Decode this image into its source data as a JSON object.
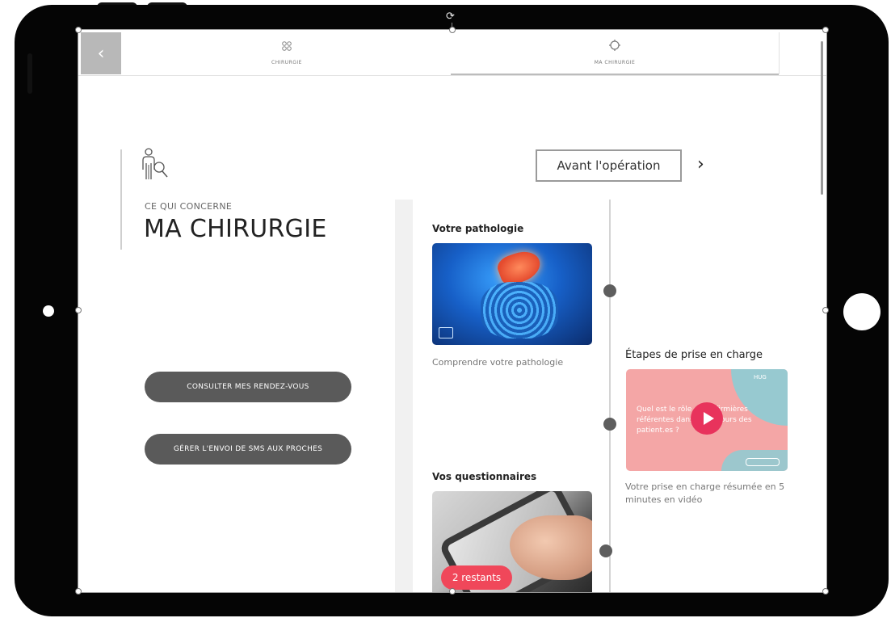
{
  "header": {
    "back_label": "‹",
    "tabs": [
      {
        "label": "CHIRURGIE",
        "icon": "molecule-icon"
      },
      {
        "label": "MA CHIRURGIE",
        "icon": "target-icon",
        "active": true
      }
    ]
  },
  "intro": {
    "eyebrow": "CE QUI CONCERNE",
    "title": "MA CHIRURGIE"
  },
  "actions": {
    "rendezvous_label": "CONSULTER MES RENDEZ-VOUS",
    "sms_label": "GÉRER L'ENVOI DE SMS AUX PROCHES"
  },
  "stage": {
    "label": "Avant l'opération",
    "next_icon": "›"
  },
  "cards": {
    "pathology": {
      "title": "Votre pathologie",
      "caption": "Comprendre votre pathologie"
    },
    "steps": {
      "title": "Étapes de prise en charge",
      "video_text": "Quel est le rôle des infirmières référentes dans le parcours des patient.es ?",
      "video_logo": "HUG",
      "caption": "Votre prise en charge résumée en 5 minutes en vidéo"
    },
    "questionnaires": {
      "title": "Vos questionnaires",
      "badge": "2 restants"
    }
  },
  "colors": {
    "pill_bg": "#5a5a5a",
    "badge_bg": "#f0475a",
    "play_bg": "#e8335c",
    "video_bg": "#f4a6a6",
    "video_accent": "#86cfd7"
  }
}
